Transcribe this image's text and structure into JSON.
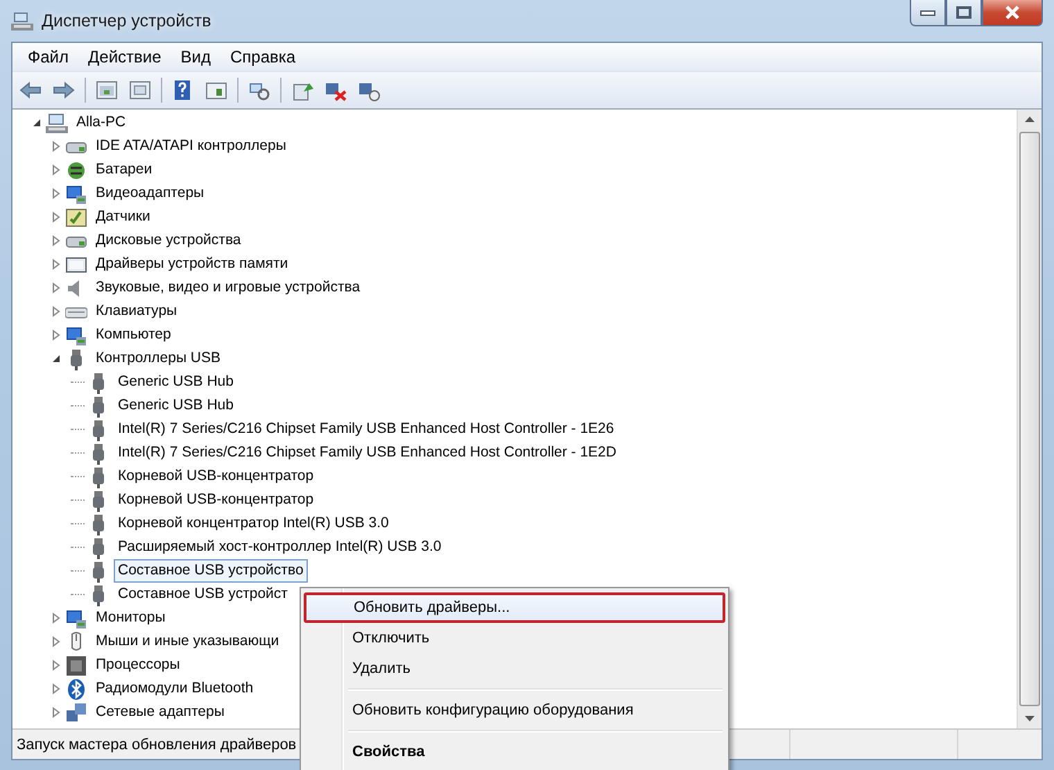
{
  "window": {
    "title": "Диспетчер устройств"
  },
  "menu_bar": [
    "Файл",
    "Действие",
    "Вид",
    "Справка"
  ],
  "tree": [
    {
      "label": "Alla-PC",
      "kind": "computer",
      "expanded": true,
      "children": [
        {
          "label": "IDE ATA/ATAPI контроллеры",
          "kind": "disk",
          "expanded": false
        },
        {
          "label": "Батареи",
          "kind": "battery",
          "expanded": false
        },
        {
          "label": "Видеоадаптеры",
          "kind": "display",
          "expanded": false
        },
        {
          "label": "Датчики",
          "kind": "sensor",
          "expanded": false
        },
        {
          "label": "Дисковые устройства",
          "kind": "disk",
          "expanded": false
        },
        {
          "label": "Драйверы устройств памяти",
          "kind": "storage",
          "expanded": false
        },
        {
          "label": "Звуковые, видео и игровые устройства",
          "kind": "sound",
          "expanded": false
        },
        {
          "label": "Клавиатуры",
          "kind": "keyboard",
          "expanded": false
        },
        {
          "label": "Компьютер",
          "kind": "display",
          "expanded": false
        },
        {
          "label": "Контроллеры USB",
          "kind": "usb",
          "expanded": true,
          "children": [
            {
              "label": "Generic USB Hub",
              "kind": "usb",
              "selected": false
            },
            {
              "label": "Generic USB Hub",
              "kind": "usb",
              "selected": false
            },
            {
              "label": "Intel(R) 7 Series/C216 Chipset Family USB Enhanced Host Controller - 1E26",
              "kind": "usb",
              "selected": false
            },
            {
              "label": "Intel(R) 7 Series/C216 Chipset Family USB Enhanced Host Controller - 1E2D",
              "kind": "usb",
              "selected": false
            },
            {
              "label": "Корневой USB-концентратор",
              "kind": "usb",
              "selected": false
            },
            {
              "label": "Корневой USB-концентратор",
              "kind": "usb",
              "selected": false
            },
            {
              "label": "Корневой концентратор Intel(R) USB 3.0",
              "kind": "usb",
              "selected": false
            },
            {
              "label": "Расширяемый хост-контроллер Intel(R) USB 3.0",
              "kind": "usb",
              "selected": false
            },
            {
              "label": "Составное USB устройство",
              "kind": "usb",
              "selected": true
            },
            {
              "label": "Составное USB устройст",
              "kind": "usb",
              "selected": false
            }
          ]
        },
        {
          "label": "Мониторы",
          "kind": "display",
          "expanded": false
        },
        {
          "label": "Мыши и иные указывающи",
          "kind": "mouse",
          "expanded": false
        },
        {
          "label": "Процессоры",
          "kind": "cpu",
          "expanded": false
        },
        {
          "label": "Радиомодули Bluetooth",
          "kind": "bluetooth",
          "expanded": false
        },
        {
          "label": "Сетевые адаптеры",
          "kind": "network",
          "expanded": false
        }
      ]
    }
  ],
  "status_bar": {
    "text": "Запуск мастера обновления драйверов"
  },
  "context_menu": {
    "groups": [
      [
        {
          "label": "Обновить драйверы...",
          "highlighted": true,
          "default": false
        },
        {
          "label": "Отключить",
          "highlighted": false,
          "default": false
        },
        {
          "label": "Удалить",
          "highlighted": false,
          "default": false
        }
      ],
      [
        {
          "label": "Обновить конфигурацию оборудования",
          "highlighted": false,
          "default": false
        }
      ],
      [
        {
          "label": "Свойства",
          "highlighted": false,
          "default": true
        }
      ]
    ]
  }
}
